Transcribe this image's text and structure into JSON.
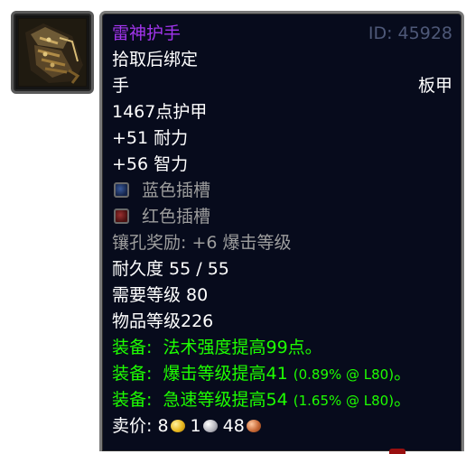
{
  "item": {
    "name": "雷神护手",
    "id_text": "ID: 45928",
    "binding": "拾取后绑定",
    "slot": "手",
    "armor_type": "板甲",
    "armor": "1467点护甲",
    "stats": [
      "+51 耐力",
      "+56 智力"
    ],
    "sockets": [
      {
        "color": "blue",
        "label": "蓝色插槽"
      },
      {
        "color": "red",
        "label": "红色插槽"
      }
    ],
    "socket_bonus": "镶孔奖励: +6 爆击等级",
    "durability": "耐久度 55 / 55",
    "required_level": "需要等级 80",
    "item_level": "物品等级226",
    "equip_effects": [
      {
        "prefix": "装备:",
        "text": "法术强度提高99点。",
        "note": ""
      },
      {
        "prefix": "装备:",
        "text": "爆击等级提高41",
        "note": "(0.89% @ L80)",
        "suffix": "。"
      },
      {
        "prefix": "装备:",
        "text": "急速等级提高54",
        "note": "(1.65% @ L80)",
        "suffix": "。"
      }
    ],
    "sell_price": {
      "label": "卖价:",
      "gold": "8",
      "silver": "1",
      "copper": "48"
    }
  },
  "colors": {
    "epic": "#a335ee",
    "equip": "#1eff00",
    "muted": "#9d9d9d",
    "id": "#4e5878",
    "background": "#070b1c"
  },
  "icons": {
    "item_icon": "plate-gauntlet-icon",
    "coins": [
      "gold-coin-icon",
      "silver-coin-icon",
      "copper-coin-icon"
    ]
  }
}
